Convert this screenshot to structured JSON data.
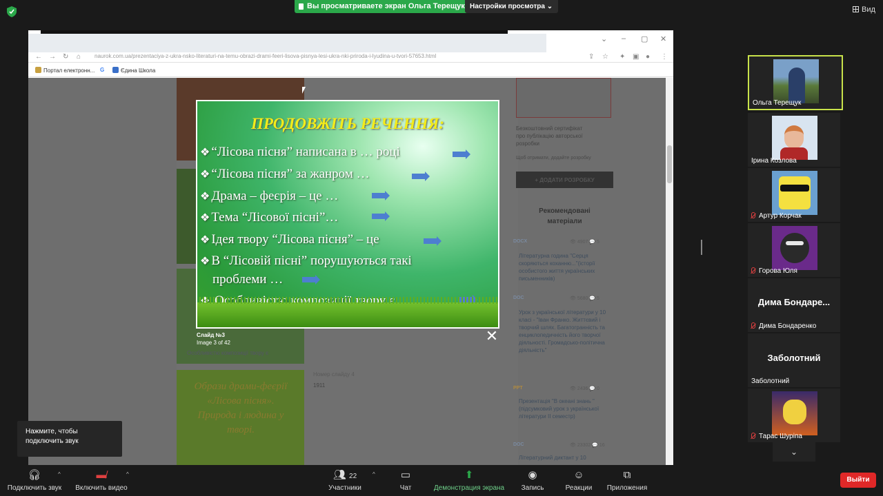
{
  "top": {
    "share_notice": "Вы просматриваете экран Ольга Терещук",
    "view_settings": "Настройки просмотра ⌄",
    "view_button": "Вид"
  },
  "browser": {
    "address": "naurok.com.ua/prezentaciya-z-ukra-nsko-literaturi-na-temu-obrazi-drami-feeri-lisova-pisnya-lesi-ukra-nki-priroda-i-lyudina-u-tvori-57653.html",
    "bookmarks": [
      "Портал електронн...",
      "G",
      "Єдина Школа"
    ]
  },
  "slide": {
    "title": "ПРОДОВЖІТЬ РЕЧЕННЯ:",
    "items": [
      "“Лісова пісня” написана в  … році",
      "“Лісова пісня” за жанром …",
      "Драма – феєрія – це …",
      "Тема  “Лісової пісні”…",
      "Ідея твору “Лісова пісня” – це",
      "В   “Лісовій   пісні”   порушуються   такі",
      "проблеми …",
      " Особливістю композиції твору є …"
    ],
    "caption_title": "Слайд №3",
    "caption_sub": "Image 3 of 42"
  },
  "background_page": {
    "certificate_text": "Безкоштовний сертифікат про публікацію авторської розробки",
    "certificate_sub": "Щоб отримати, додайте розробку",
    "add_button": "+ ДОДАТИ РОЗРОБКУ",
    "recommended_title": "Рекомендовані матеріали",
    "materials": [
      {
        "badge": "DOCX",
        "stats": "👁 4907  💬 5",
        "title": "Літературна година \"Серця скоряються коханню...\"(історії особистого життя українських письменників)"
      },
      {
        "badge": "DOC",
        "stats": "👁 5680  💬 5",
        "title": "Урок з української літератури у 10 класі - \"Іван Франко. Життєвий і творчий шлях. Багатогранність та енциклопедичність його творчої діяльності. Громадсько-політична діяльність\""
      },
      {
        "badge": "PPT",
        "stats": "👁 2436  💬 0",
        "title": "Презентація \"В океані знань \" (підсумковий урок з української літератури ІІ семестр)"
      },
      {
        "badge": "DOC",
        "stats": "👁 23302  💬 16",
        "title": "Літературний диктант у 10"
      }
    ],
    "thumb_text": "Образи драми-феєрії «Лісова пісня». Природа і людина у творі.",
    "slide_label": "Номер слайду 4",
    "slide_num": "1911",
    "thumb_small": "Особливістю композиції твору є"
  },
  "participants": [
    {
      "name": "Ольга Терещук",
      "muted": false,
      "video": true,
      "active": true
    },
    {
      "name": "Ірина Козлова",
      "muted": false,
      "video": true,
      "active": false
    },
    {
      "name": "Артур Корчак",
      "muted": true,
      "video": true,
      "active": false
    },
    {
      "name": "Горова Юля",
      "muted": true,
      "video": true,
      "active": false
    },
    {
      "name": "Дима Бондаренко",
      "big": "Дима Бондаре...",
      "muted": true,
      "video": false,
      "active": false
    },
    {
      "name": "Заболотний",
      "big": "Заболотний",
      "muted": false,
      "video": false,
      "active": false
    },
    {
      "name": "Тарас Шуріпа",
      "muted": true,
      "video": true,
      "active": false
    }
  ],
  "toast": {
    "line1": "Нажмите, чтобы",
    "line2": "подключить звук"
  },
  "toolbar": {
    "audio": "Подключить звук",
    "video": "Включить видео",
    "participants": "Участники",
    "participants_count": "22",
    "chat": "Чат",
    "share": "Демонстрация экрана",
    "record": "Запись",
    "reactions": "Реакции",
    "apps": "Приложения",
    "leave": "Выйти"
  },
  "colors": {
    "share_green": "#2ba84a",
    "leave_red": "#e02828",
    "active_border": "#c9e34a",
    "slide_title": "#f3ec1a"
  }
}
